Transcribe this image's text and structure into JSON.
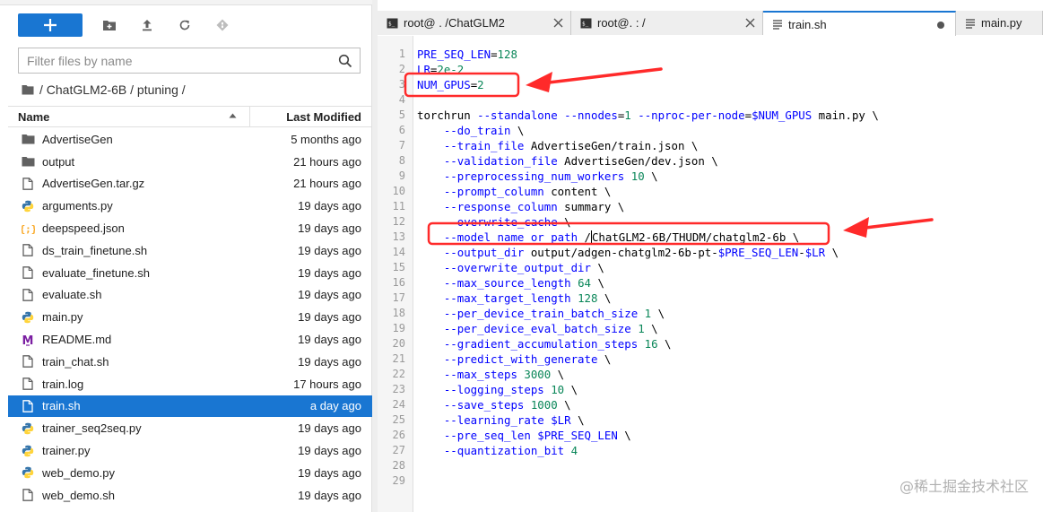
{
  "toolbar": {
    "new_icon": "plus-icon",
    "icons": [
      "new-folder-icon",
      "upload-icon",
      "refresh-icon",
      "git-icon"
    ]
  },
  "filter": {
    "placeholder": "Filter files by name"
  },
  "breadcrumb": {
    "text": "/ ChatGLM2-6B / ptuning /"
  },
  "list_header": {
    "name": "Name",
    "last_modified": "Last Modified"
  },
  "files": [
    {
      "name": "AdvertiseGen",
      "modified": "5 months ago",
      "type": "folder"
    },
    {
      "name": "output",
      "modified": "21 hours ago",
      "type": "folder"
    },
    {
      "name": "AdvertiseGen.tar.gz",
      "modified": "21 hours ago",
      "type": "file"
    },
    {
      "name": "arguments.py",
      "modified": "19 days ago",
      "type": "python"
    },
    {
      "name": "deepspeed.json",
      "modified": "19 days ago",
      "type": "json"
    },
    {
      "name": "ds_train_finetune.sh",
      "modified": "19 days ago",
      "type": "file"
    },
    {
      "name": "evaluate_finetune.sh",
      "modified": "19 days ago",
      "type": "file"
    },
    {
      "name": "evaluate.sh",
      "modified": "19 days ago",
      "type": "file"
    },
    {
      "name": "main.py",
      "modified": "19 days ago",
      "type": "python"
    },
    {
      "name": "README.md",
      "modified": "19 days ago",
      "type": "markdown"
    },
    {
      "name": "train_chat.sh",
      "modified": "19 days ago",
      "type": "file"
    },
    {
      "name": "train.log",
      "modified": "17 hours ago",
      "type": "file"
    },
    {
      "name": "train.sh",
      "modified": "a day ago",
      "type": "file",
      "selected": true
    },
    {
      "name": "trainer_seq2seq.py",
      "modified": "19 days ago",
      "type": "python"
    },
    {
      "name": "trainer.py",
      "modified": "19 days ago",
      "type": "python"
    },
    {
      "name": "web_demo.py",
      "modified": "19 days ago",
      "type": "python"
    },
    {
      "name": "web_demo.sh",
      "modified": "19 days ago",
      "type": "file"
    }
  ],
  "tabs": [
    {
      "label": "root@           . /ChatGLM2",
      "icon": "terminal-icon",
      "close": true
    },
    {
      "label": "root@.           : /",
      "icon": "terminal-icon",
      "close": true
    },
    {
      "label": "train.sh",
      "icon": "text-file-icon",
      "active": true,
      "dirty": true
    },
    {
      "label": "main.py",
      "icon": "text-file-icon"
    }
  ],
  "code_lines": [
    [
      {
        "t": "PRE_SEQ_LEN",
        "c": "var"
      },
      {
        "t": "="
      },
      {
        "t": "128",
        "c": "num"
      }
    ],
    [
      {
        "t": "LR",
        "c": "var"
      },
      {
        "t": "="
      },
      {
        "t": "2e-2",
        "c": "num"
      }
    ],
    [
      {
        "t": "NUM_GPUS",
        "c": "var"
      },
      {
        "t": "="
      },
      {
        "t": "2",
        "c": "num"
      }
    ],
    [],
    [
      {
        "t": "torchrun "
      },
      {
        "t": "--standalone",
        "c": "flag"
      },
      {
        "t": " "
      },
      {
        "t": "--nnodes",
        "c": "flag"
      },
      {
        "t": "="
      },
      {
        "t": "1",
        "c": "num"
      },
      {
        "t": " "
      },
      {
        "t": "--nproc-per-node",
        "c": "flag"
      },
      {
        "t": "="
      },
      {
        "t": "$NUM_GPUS",
        "c": "var"
      },
      {
        "t": " main.py \\"
      }
    ],
    [
      {
        "t": "    "
      },
      {
        "t": "--do_train",
        "c": "flag"
      },
      {
        "t": " \\"
      }
    ],
    [
      {
        "t": "    "
      },
      {
        "t": "--train_file",
        "c": "flag"
      },
      {
        "t": " AdvertiseGen/train.json \\"
      }
    ],
    [
      {
        "t": "    "
      },
      {
        "t": "--validation_file",
        "c": "flag"
      },
      {
        "t": " AdvertiseGen/dev.json \\"
      }
    ],
    [
      {
        "t": "    "
      },
      {
        "t": "--preprocessing_num_workers",
        "c": "flag"
      },
      {
        "t": " "
      },
      {
        "t": "10",
        "c": "num"
      },
      {
        "t": " \\"
      }
    ],
    [
      {
        "t": "    "
      },
      {
        "t": "--prompt_column",
        "c": "flag"
      },
      {
        "t": " content \\"
      }
    ],
    [
      {
        "t": "    "
      },
      {
        "t": "--response_column",
        "c": "flag"
      },
      {
        "t": " summary \\"
      }
    ],
    [
      {
        "t": "    "
      },
      {
        "t": "--overwrite_cache",
        "c": "flag"
      },
      {
        "t": " \\"
      }
    ],
    [
      {
        "t": "    "
      },
      {
        "t": "--model_name_or_path",
        "c": "flag"
      },
      {
        "t": " /"
      },
      {
        "cursor": true
      },
      {
        "t": "ChatGLM2-6B/THUDM/chatglm2-6b \\"
      }
    ],
    [
      {
        "t": "    "
      },
      {
        "t": "--output_dir",
        "c": "flag"
      },
      {
        "t": " output/adgen-chatglm2-6b-pt-"
      },
      {
        "t": "$PRE_SEQ_LEN",
        "c": "var"
      },
      {
        "t": "-"
      },
      {
        "t": "$LR",
        "c": "var"
      },
      {
        "t": " \\"
      }
    ],
    [
      {
        "t": "    "
      },
      {
        "t": "--overwrite_output_dir",
        "c": "flag"
      },
      {
        "t": " \\"
      }
    ],
    [
      {
        "t": "    "
      },
      {
        "t": "--max_source_length",
        "c": "flag"
      },
      {
        "t": " "
      },
      {
        "t": "64",
        "c": "num"
      },
      {
        "t": " \\"
      }
    ],
    [
      {
        "t": "    "
      },
      {
        "t": "--max_target_length",
        "c": "flag"
      },
      {
        "t": " "
      },
      {
        "t": "128",
        "c": "num"
      },
      {
        "t": " \\"
      }
    ],
    [
      {
        "t": "    "
      },
      {
        "t": "--per_device_train_batch_size",
        "c": "flag"
      },
      {
        "t": " "
      },
      {
        "t": "1",
        "c": "num"
      },
      {
        "t": " \\"
      }
    ],
    [
      {
        "t": "    "
      },
      {
        "t": "--per_device_eval_batch_size",
        "c": "flag"
      },
      {
        "t": " "
      },
      {
        "t": "1",
        "c": "num"
      },
      {
        "t": " \\"
      }
    ],
    [
      {
        "t": "    "
      },
      {
        "t": "--gradient_accumulation_steps",
        "c": "flag"
      },
      {
        "t": " "
      },
      {
        "t": "16",
        "c": "num"
      },
      {
        "t": " \\"
      }
    ],
    [
      {
        "t": "    "
      },
      {
        "t": "--predict_with_generate",
        "c": "flag"
      },
      {
        "t": " \\"
      }
    ],
    [
      {
        "t": "    "
      },
      {
        "t": "--max_steps",
        "c": "flag"
      },
      {
        "t": " "
      },
      {
        "t": "3000",
        "c": "num"
      },
      {
        "t": " \\"
      }
    ],
    [
      {
        "t": "    "
      },
      {
        "t": "--logging_steps",
        "c": "flag"
      },
      {
        "t": " "
      },
      {
        "t": "10",
        "c": "num"
      },
      {
        "t": " \\"
      }
    ],
    [
      {
        "t": "    "
      },
      {
        "t": "--save_steps",
        "c": "flag"
      },
      {
        "t": " "
      },
      {
        "t": "1000",
        "c": "num"
      },
      {
        "t": " \\"
      }
    ],
    [
      {
        "t": "    "
      },
      {
        "t": "--learning_rate",
        "c": "flag"
      },
      {
        "t": " "
      },
      {
        "t": "$LR",
        "c": "var"
      },
      {
        "t": " \\"
      }
    ],
    [
      {
        "t": "    "
      },
      {
        "t": "--pre_seq_len",
        "c": "flag"
      },
      {
        "t": " "
      },
      {
        "t": "$PRE_SEQ_LEN",
        "c": "var"
      },
      {
        "t": " \\"
      }
    ],
    [
      {
        "t": "    "
      },
      {
        "t": "--quantization_bit",
        "c": "flag"
      },
      {
        "t": " "
      },
      {
        "t": "4",
        "c": "num"
      }
    ],
    [],
    []
  ],
  "watermark": "@稀土掘金技术社区",
  "colors": {
    "accent": "#1976d2",
    "annotation": "#ff2a2a"
  }
}
